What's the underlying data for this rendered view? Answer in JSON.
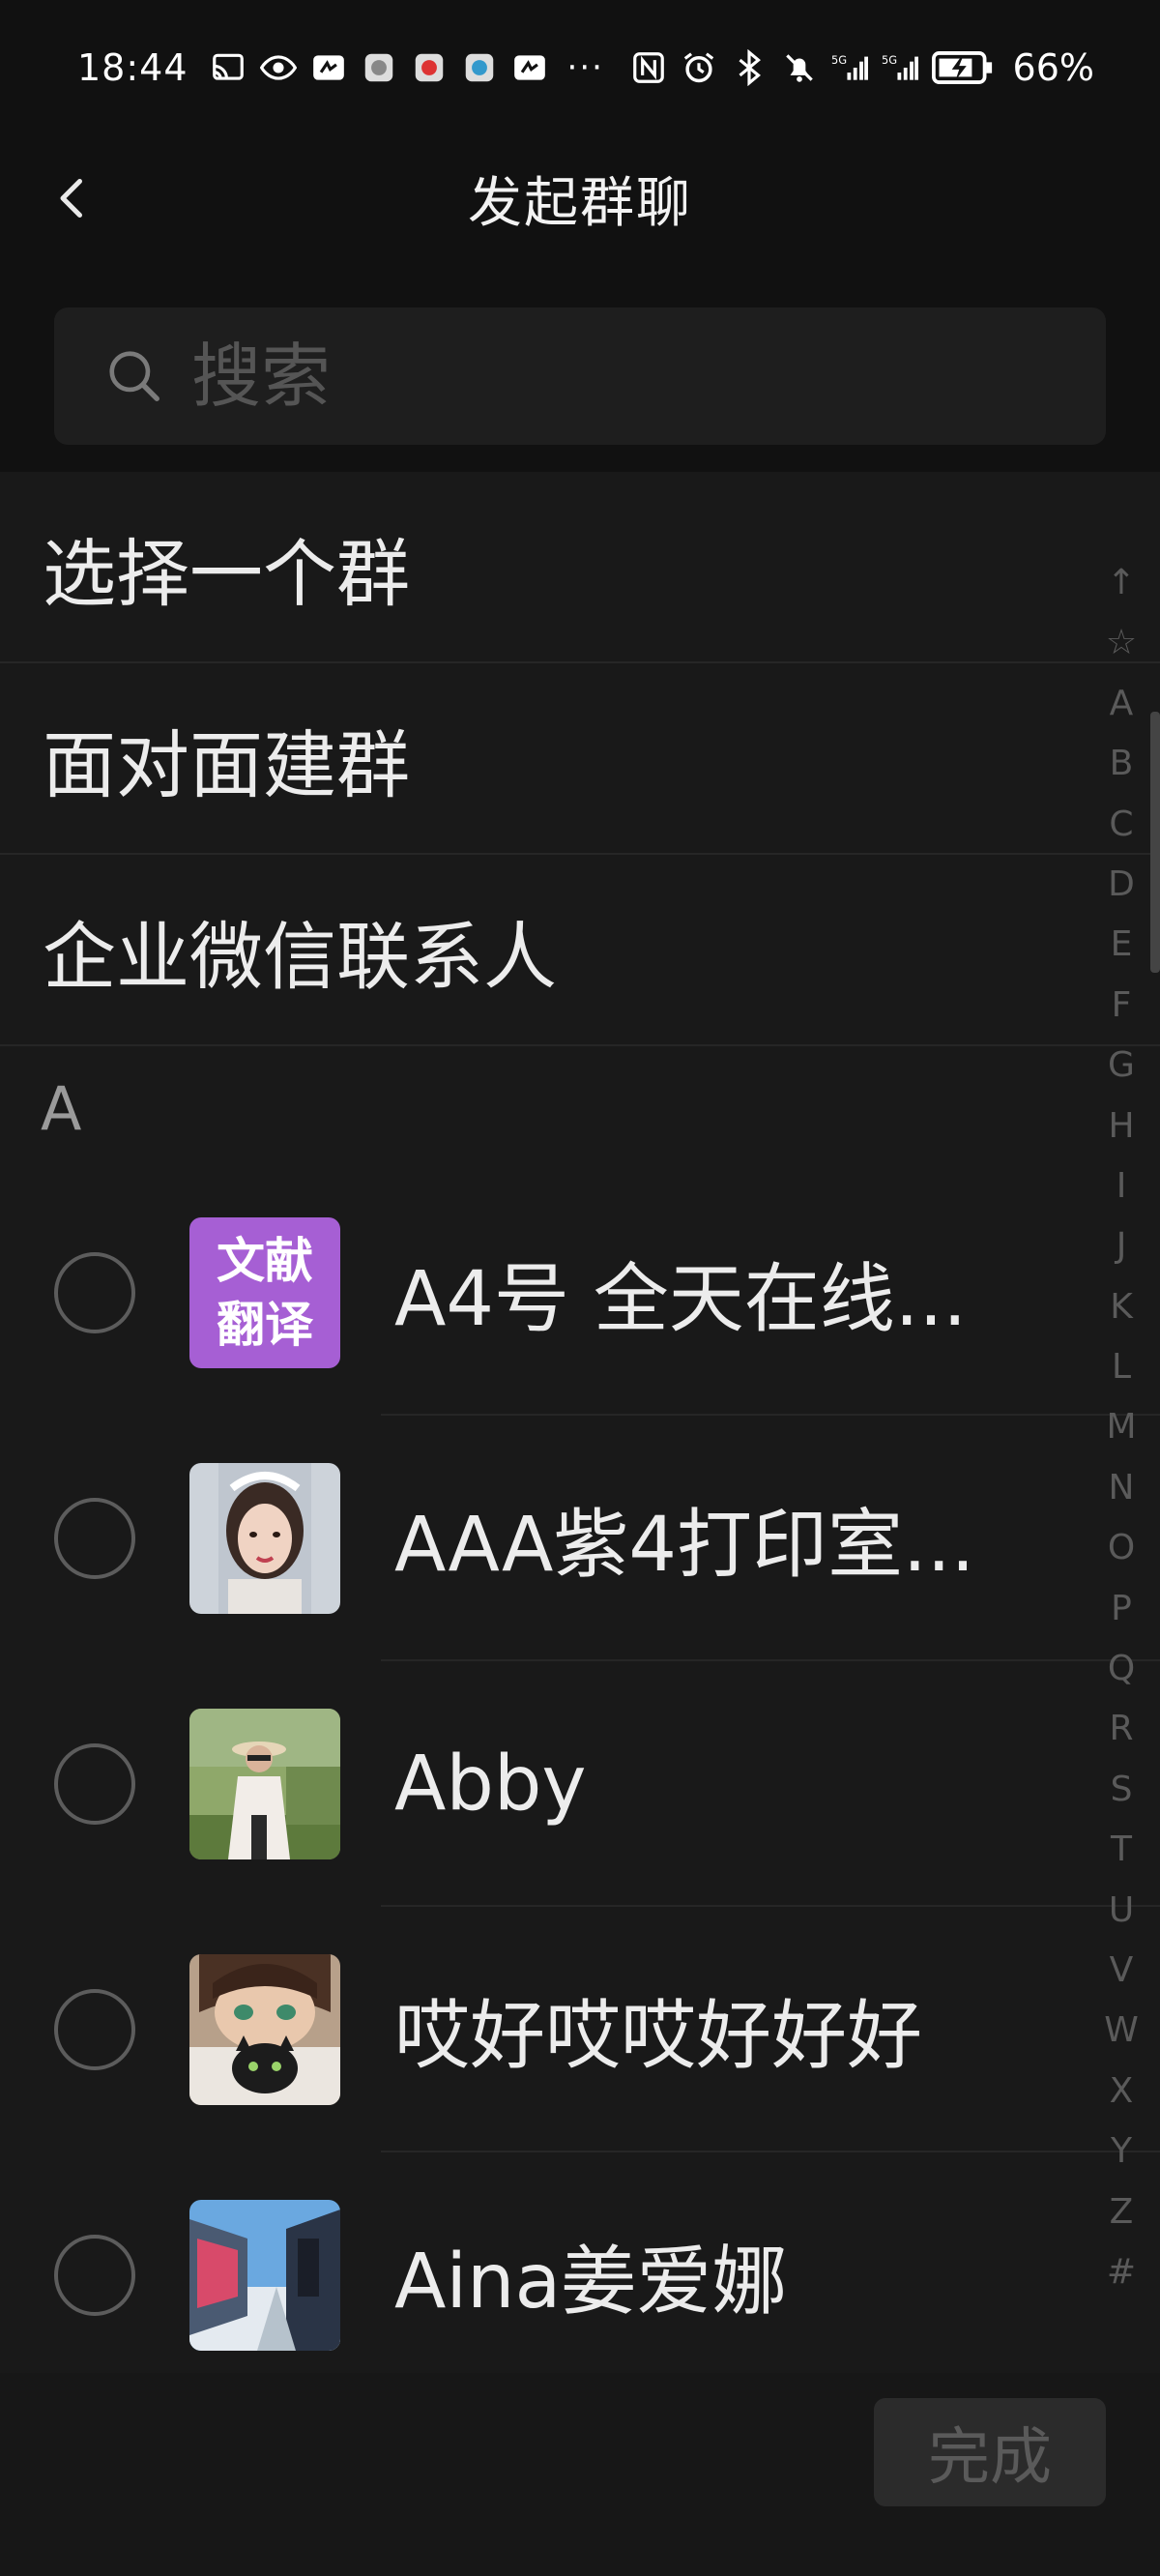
{
  "status_bar": {
    "time": "18:44",
    "left_icons": [
      "cast-icon",
      "eye-icon",
      "app-icon",
      "app-icon",
      "app-icon",
      "app-icon",
      "app-icon"
    ],
    "more": "···",
    "right_icons": [
      "nfc-icon",
      "alarm-icon",
      "bluetooth-icon",
      "mute-icon",
      "signal-5g-icon",
      "signal-5g-icon",
      "battery-icon"
    ],
    "battery_percent": "66%"
  },
  "header": {
    "title": "发起群聊"
  },
  "search": {
    "placeholder": "搜索"
  },
  "menu": [
    {
      "label": "选择一个群"
    },
    {
      "label": "面对面建群"
    },
    {
      "label": "企业微信联系人"
    }
  ],
  "section": {
    "letter": "A"
  },
  "contacts": [
    {
      "name": "A4号 全天在线...",
      "avatar_text": [
        "文献",
        "翻译"
      ],
      "avatar_color": "#a65fd4"
    },
    {
      "name": "AAA紫4打印室...",
      "avatar": "photo-woman-icon"
    },
    {
      "name": "Abby",
      "avatar": "photo-outdoor-icon"
    },
    {
      "name": "哎好哎哎好好好",
      "avatar": "anime-cat-icon"
    },
    {
      "name": "Aina姜爱娜",
      "avatar": "photo-street-icon"
    }
  ],
  "index": [
    "↑",
    "☆",
    "A",
    "B",
    "C",
    "D",
    "E",
    "F",
    "G",
    "H",
    "I",
    "J",
    "K",
    "L",
    "M",
    "N",
    "O",
    "P",
    "Q",
    "R",
    "S",
    "T",
    "U",
    "V",
    "W",
    "X",
    "Y",
    "Z",
    "#"
  ],
  "footer": {
    "done_label": "完成"
  }
}
